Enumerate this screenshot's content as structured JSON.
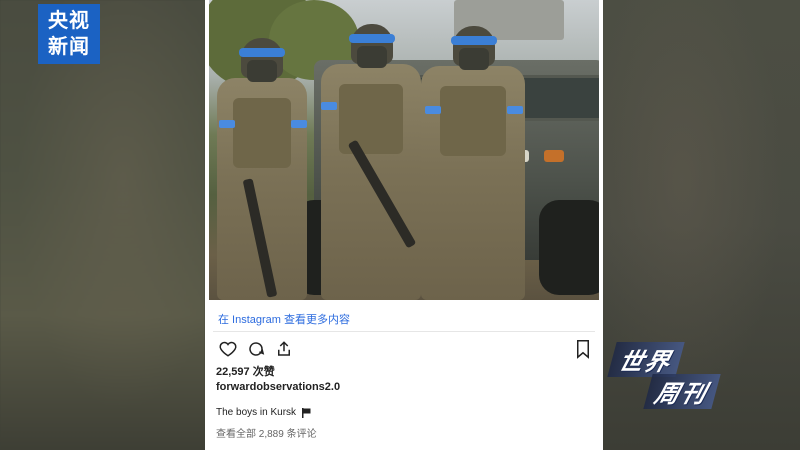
{
  "logo": {
    "line1": "央视",
    "line2": "新闻"
  },
  "post": {
    "view_link": "在 Instagram 查看更多内容",
    "likes": "22,597 次赞",
    "username": "forwardobservations2.0",
    "caption": "The boys in Kursk",
    "comments": "查看全部 2,889 条评论"
  },
  "icons": {
    "like": "heart-icon",
    "comment": "comment-icon",
    "share": "share-icon",
    "save": "bookmark-icon",
    "flag": "flag-icon"
  },
  "watermark": {
    "line1": "世界",
    "line2": "周刊"
  },
  "colors": {
    "logo_bg": "#1b62c3",
    "link": "#2d6cdf",
    "armband": "#3b7fd6"
  }
}
